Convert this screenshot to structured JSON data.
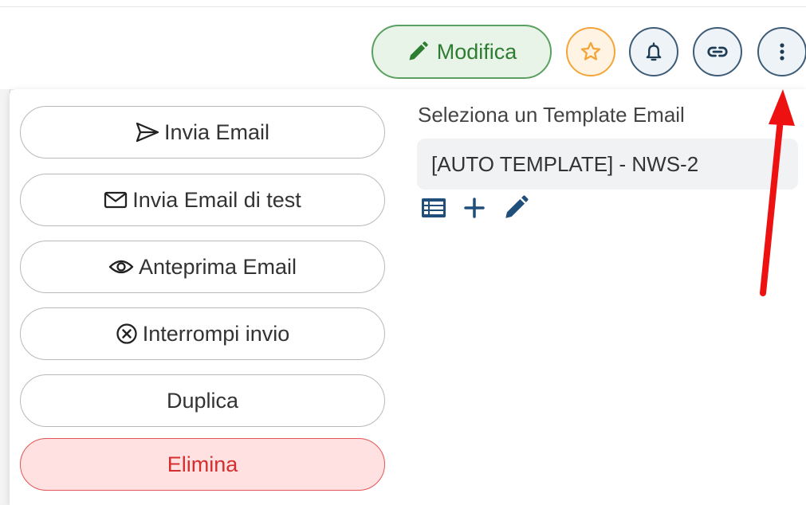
{
  "toolbar": {
    "edit_label": "Modifica",
    "icons": [
      "pencil-icon",
      "star-icon",
      "bell-icon",
      "link-icon",
      "more-vertical-icon"
    ],
    "colors": {
      "edit": "#2e7d32",
      "star": "#f4a53a",
      "neutral": "#3e5c76"
    }
  },
  "menu": {
    "actions": [
      {
        "label": "Invia Email",
        "icon": "send-icon"
      },
      {
        "label": "Invia Email di test",
        "icon": "mail-icon"
      },
      {
        "label": "Anteprima Email",
        "icon": "eye-icon"
      },
      {
        "label": "Interrompi invio",
        "icon": "stop-circle-icon"
      },
      {
        "label": "Duplica"
      },
      {
        "label": "Elimina",
        "icon": "",
        "color": "#d32f2f"
      }
    ],
    "template": {
      "label": "Seleziona un Template Email",
      "selected": "[AUTO TEMPLATE] - NWS-2",
      "icons": [
        "list-icon",
        "plus-icon",
        "pencil-icon"
      ],
      "icon_color": "#1f4f7a"
    }
  },
  "annotation": {
    "arrow_color": "#ee1111"
  }
}
